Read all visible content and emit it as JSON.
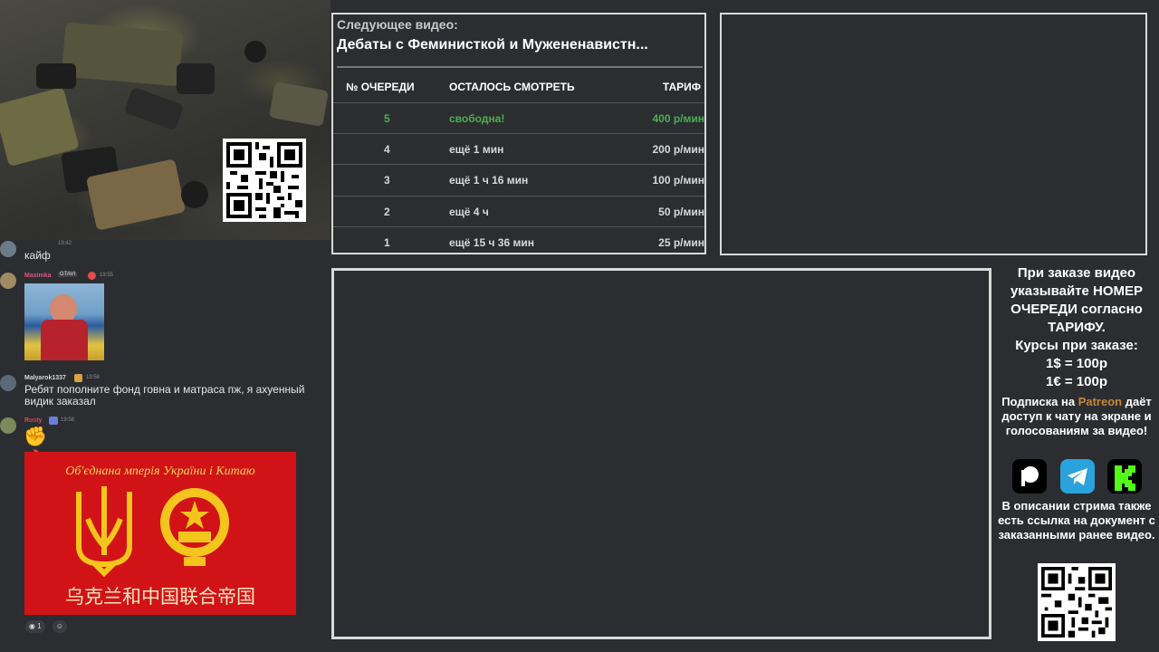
{
  "chat": {
    "msg1": {
      "time": "19:42",
      "text": "кайф"
    },
    "msg2": {
      "user": "Maximka",
      "badge": "GTAVI",
      "time": "19:55"
    },
    "msg3": {
      "user": "Malyarok1337",
      "time": "19:58",
      "text": "Ребят пополните фонд говна и матраса пж, я ахуенный видик заказал"
    },
    "msg4": {
      "user": "Rusty",
      "time": "19:58",
      "emojis": "✊🔥🫣"
    },
    "flag": {
      "title": "Об'єднана мперія України і Китаю",
      "subtitle": "乌克兰和中国联合帝国"
    },
    "reactions": {
      "count": "1"
    }
  },
  "queue": {
    "next_label": "Следующее видео:",
    "next_title": "Дебаты с Феминисткой и Мужененавистн...",
    "headers": {
      "num": "№ ОЧЕРЕДИ",
      "remaining": "ОСТАЛОСЬ СМОТРЕТЬ",
      "tariff": "ТАРИФ"
    },
    "rows": [
      {
        "num": "5",
        "remaining": "свободна!",
        "tariff": "400 р/мин"
      },
      {
        "num": "4",
        "remaining": "ещё 1 мин",
        "tariff": "200 р/мин"
      },
      {
        "num": "3",
        "remaining": "ещё 1 ч 16 мин",
        "tariff": "100 р/мин"
      },
      {
        "num": "2",
        "remaining": "ещё 4 ч",
        "tariff": "50 р/мин"
      },
      {
        "num": "1",
        "remaining": "ещё 15 ч 36 мин",
        "tariff": "25 р/мин"
      }
    ]
  },
  "info": {
    "order_note": "При заказе видео указывайте НОМЕР ОЧЕРЕДИ согласно ТАРИФУ.",
    "rates_title": "Курсы при заказе:",
    "rate_usd": "1$ = 100р",
    "rate_eur": "1€ = 100р",
    "sub_prefix": "Подписка на ",
    "sub_patreon": "Patreon",
    "sub_rest": " даёт доступ к чату на экране и голосованиям за видео!",
    "doc_note": "В описании стрима также есть ссылка на документ с заказанными ранее видео."
  },
  "colors": {
    "free": "#4caf50",
    "patreon": "#c8873a",
    "telegram": "#2aa3dc",
    "kick": "#53fc18"
  },
  "icons": [
    "patreon-icon",
    "telegram-icon",
    "kick-icon"
  ]
}
